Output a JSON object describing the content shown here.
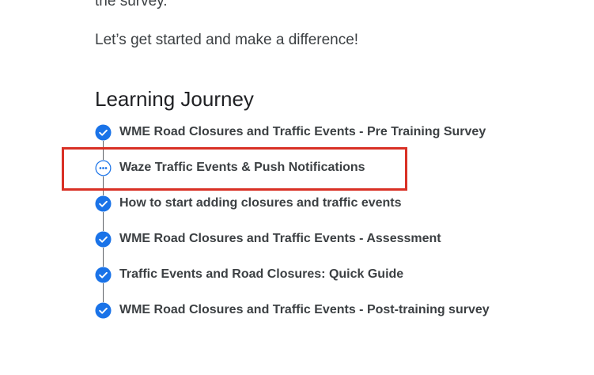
{
  "content": {
    "cut_off_line": "the survey.",
    "intro_text": "Let’s get started and make a difference!"
  },
  "learning_journey": {
    "title": "Learning Journey",
    "items": [
      {
        "label": "WME Road Closures and Traffic Events - Pre Training Survey",
        "status": "completed",
        "icon": "check-circle-icon"
      },
      {
        "label": "Waze Traffic Events & Push Notifications",
        "status": "in-progress",
        "icon": "more-horizontal-circle-icon"
      },
      {
        "label": "How to start adding closures and traffic events",
        "status": "completed",
        "icon": "check-circle-icon"
      },
      {
        "label": "WME Road Closures and Traffic Events - Assessment",
        "status": "completed",
        "icon": "check-circle-icon"
      },
      {
        "label": "Traffic Events and Road Closures: Quick Guide",
        "status": "completed",
        "icon": "check-circle-icon"
      },
      {
        "label": "WME Road Closures and Traffic Events - Post-training survey",
        "status": "completed",
        "icon": "check-circle-icon"
      }
    ]
  },
  "colors": {
    "accent": "#1a73e8",
    "text": "#3c4043",
    "heading": "#202124",
    "highlight": "#d93025"
  }
}
